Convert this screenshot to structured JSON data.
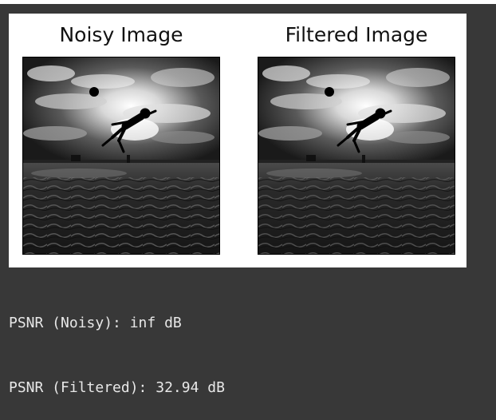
{
  "figure": {
    "panels": [
      {
        "title": "Noisy Image"
      },
      {
        "title": "Filtered Image"
      }
    ]
  },
  "output": {
    "lines": [
      "PSNR (Noisy): inf dB",
      "PSNR (Filtered): 32.94 dB"
    ]
  },
  "colors": {
    "background": "#383838",
    "figure_background": "#ffffff",
    "output_text": "#e8e8e8"
  }
}
